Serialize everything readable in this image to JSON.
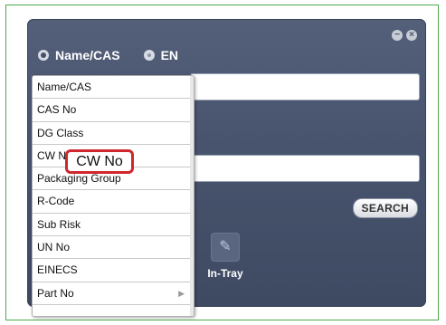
{
  "search_modes": [
    {
      "label": "Name/CAS",
      "selected": true
    },
    {
      "label": "EN",
      "selected": false
    }
  ],
  "window_buttons": {
    "minimize": "−",
    "close": "×"
  },
  "search_button": "SEARCH",
  "tray": {
    "label": "In-Tray",
    "icon": "in-tray-icon"
  },
  "dropdown": {
    "items": [
      {
        "label": "Name/CAS"
      },
      {
        "label": "CAS No"
      },
      {
        "label": "DG Class"
      },
      {
        "label": "CW No"
      },
      {
        "label": "Packaging Group"
      },
      {
        "label": "R-Code"
      },
      {
        "label": "Sub Risk"
      },
      {
        "label": "UN No"
      },
      {
        "label": "EINECS"
      },
      {
        "label": "Part No",
        "has_submenu": true
      }
    ]
  },
  "callout": "CW No",
  "colors": {
    "panel": "#48546d",
    "frame_border": "#4caa4c",
    "callout_border": "#d0262d"
  }
}
